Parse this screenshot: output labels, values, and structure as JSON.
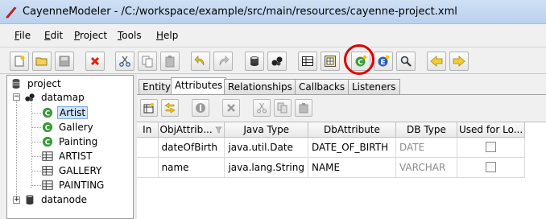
{
  "window": {
    "title": "CayenneModeler - /C:/workspace/example/src/main/resources/cayenne-project.xml"
  },
  "menu": [
    {
      "label": "File",
      "mnemonic": "F",
      "rest": "ile"
    },
    {
      "label": "Edit",
      "mnemonic": "E",
      "rest": "dit"
    },
    {
      "label": "Project",
      "mnemonic": "P",
      "rest": "roject"
    },
    {
      "label": "Tools",
      "mnemonic": "T",
      "rest": "ools"
    },
    {
      "label": "Help",
      "mnemonic": "H",
      "rest": "elp"
    }
  ],
  "toolbar_icons": [
    "new-project-icon",
    "open-project-icon",
    "save-icon",
    "remove-icon",
    "cut-icon",
    "copy-icon",
    "paste-icon",
    "undo-icon",
    "redo-icon",
    "create-datamap-icon",
    "create-datanode-icon",
    "create-dbentity-icon",
    "create-embeddable-icon",
    "create-objentity-icon",
    "create-procedure-icon",
    "create-query-icon",
    "navigate-back-icon",
    "navigate-forward-icon"
  ],
  "tree": {
    "root": "project",
    "datamap": "datamap",
    "obj_entities": [
      "Artist",
      "Gallery",
      "Painting"
    ],
    "db_entities": [
      "ARTIST",
      "GALLERY",
      "PAINTING"
    ],
    "datanode": "datanode",
    "selected": "Artist"
  },
  "tabs": [
    "Entity",
    "Attributes",
    "Relationships",
    "Callbacks",
    "Listeners"
  ],
  "active_tab": "Attributes",
  "attributes_table": {
    "columns": [
      "In",
      "ObjAttrib...",
      "Java Type",
      "DbAttribute",
      "DB Type",
      "Used for Lo..."
    ],
    "rows": [
      {
        "in": "",
        "obj_attribute": "dateOfBirth",
        "java_type": "java.util.Date",
        "db_attribute": "DATE_OF_BIRTH",
        "db_type": "DATE",
        "used_for_locking": false
      },
      {
        "in": "",
        "obj_attribute": "name",
        "java_type": "java.lang.String",
        "db_attribute": "NAME",
        "db_type": "VARCHAR",
        "used_for_locking": false
      }
    ]
  },
  "colors": {
    "highlight": "#e00000",
    "selection": "#cfe3fb",
    "entity_icon": "#3a9a3a"
  }
}
